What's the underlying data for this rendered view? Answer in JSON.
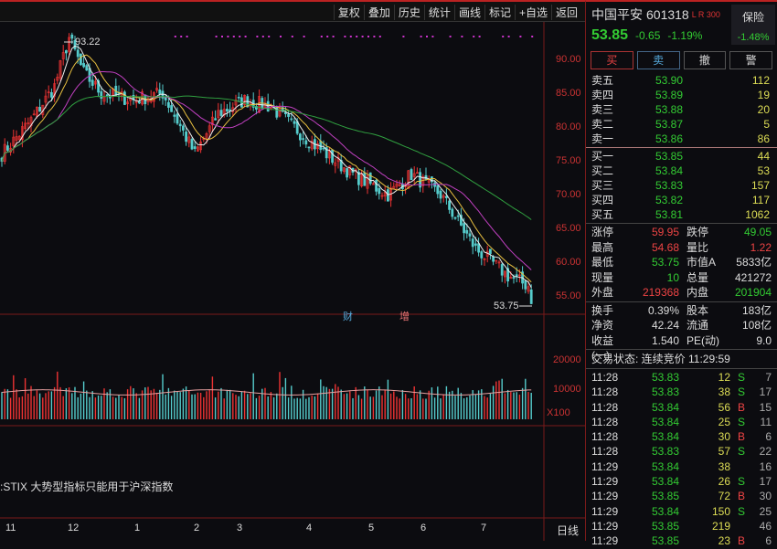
{
  "toolbar": [
    "复权",
    "叠加",
    "历史",
    "统计",
    "画线",
    "标记",
    "+自选",
    "返回"
  ],
  "stock": {
    "name": "中国平安",
    "code": "601318",
    "tag": "L R 300",
    "last": "53.85",
    "change": "-0.65",
    "pct": "-1.19%",
    "sector": "保险",
    "sector_pct": "-1.48%"
  },
  "actions": [
    "买",
    "卖",
    "撤",
    "警"
  ],
  "asks": [
    [
      "卖五",
      "53.90",
      "112"
    ],
    [
      "卖四",
      "53.89",
      "19"
    ],
    [
      "卖三",
      "53.88",
      "20"
    ],
    [
      "卖二",
      "53.87",
      "5"
    ],
    [
      "卖一",
      "53.86",
      "86"
    ]
  ],
  "bids": [
    [
      "买一",
      "53.85",
      "44"
    ],
    [
      "买二",
      "53.84",
      "53"
    ],
    [
      "买三",
      "53.83",
      "157"
    ],
    [
      "买四",
      "53.82",
      "117"
    ],
    [
      "买五",
      "53.81",
      "1062"
    ]
  ],
  "stats1": [
    [
      "涨停",
      "59.95",
      "red",
      "跌停",
      "49.05",
      "green"
    ],
    [
      "最高",
      "54.68",
      "red",
      "量比",
      "1.22",
      "red"
    ],
    [
      "最低",
      "53.75",
      "green",
      "市值A",
      "5833亿",
      ""
    ],
    [
      "现量",
      "10",
      "green",
      "总量",
      "421272",
      ""
    ],
    [
      "外盘",
      "219368",
      "red",
      "内盘",
      "201904",
      "green"
    ]
  ],
  "stats2": [
    [
      "换手",
      "0.39%",
      "股本",
      "183亿"
    ],
    [
      "净资",
      "42.24",
      "流通",
      "108亿"
    ],
    [
      "收益(一)",
      "1.540",
      "PE(动)",
      "9.0"
    ]
  ],
  "trade_status": "交易状态: 连续竞价 11:29:59",
  "trades": [
    [
      "11:28",
      "53.83",
      "12",
      "S",
      "7"
    ],
    [
      "11:28",
      "53.83",
      "38",
      "S",
      "17"
    ],
    [
      "11:28",
      "53.84",
      "56",
      "B",
      "15"
    ],
    [
      "11:28",
      "53.84",
      "25",
      "S",
      "11"
    ],
    [
      "11:28",
      "53.84",
      "30",
      "B",
      "6"
    ],
    [
      "11:28",
      "53.83",
      "57",
      "S",
      "22"
    ],
    [
      "11:29",
      "53.84",
      "38",
      "",
      "16"
    ],
    [
      "11:29",
      "53.84",
      "26",
      "S",
      "17"
    ],
    [
      "11:29",
      "53.85",
      "72",
      "B",
      "30"
    ],
    [
      "11:29",
      "53.84",
      "150",
      "S",
      "25"
    ],
    [
      "11:29",
      "53.85",
      "219",
      "",
      "46"
    ],
    [
      "11:29",
      "53.85",
      "23",
      "B",
      "6"
    ]
  ],
  "price_axis": [
    "90.00",
    "85.00",
    "80.00",
    "75.00",
    "70.00",
    "65.00",
    "60.00",
    "55.00"
  ],
  "vol_axis": [
    "20000",
    "10000",
    "X100"
  ],
  "months": [
    "11",
    "12",
    "1",
    "2",
    "3",
    "4",
    "5",
    "6",
    "7"
  ],
  "period": "日线",
  "high_label": "93.22",
  "low_label": "53.75",
  "markers": [
    "财",
    "增"
  ],
  "indicator_note": ":STIX 大势型指标只能用于沪深指数",
  "chart_data": {
    "type": "candlestick",
    "days": 182,
    "price_keypoints": [
      [
        0,
        76
      ],
      [
        10,
        81
      ],
      [
        18,
        86
      ],
      [
        23,
        93.22
      ],
      [
        28,
        88
      ],
      [
        34,
        85
      ],
      [
        45,
        84
      ],
      [
        55,
        85
      ],
      [
        66,
        76
      ],
      [
        74,
        82
      ],
      [
        83,
        84
      ],
      [
        92,
        83
      ],
      [
        105,
        78
      ],
      [
        120,
        73
      ],
      [
        132,
        70
      ],
      [
        140,
        73
      ],
      [
        150,
        70
      ],
      [
        162,
        62
      ],
      [
        173,
        58
      ],
      [
        180,
        56.5
      ],
      [
        181,
        53.85
      ]
    ],
    "ylim": [
      53,
      93.5
    ],
    "vol_ylim": [
      0,
      22000
    ],
    "colors": {
      "up": "#e33",
      "down": "#5cc",
      "ma5": "#eee",
      "ma10": "#e8c040",
      "ma20": "#c040c0",
      "ma60": "#30a040"
    }
  }
}
